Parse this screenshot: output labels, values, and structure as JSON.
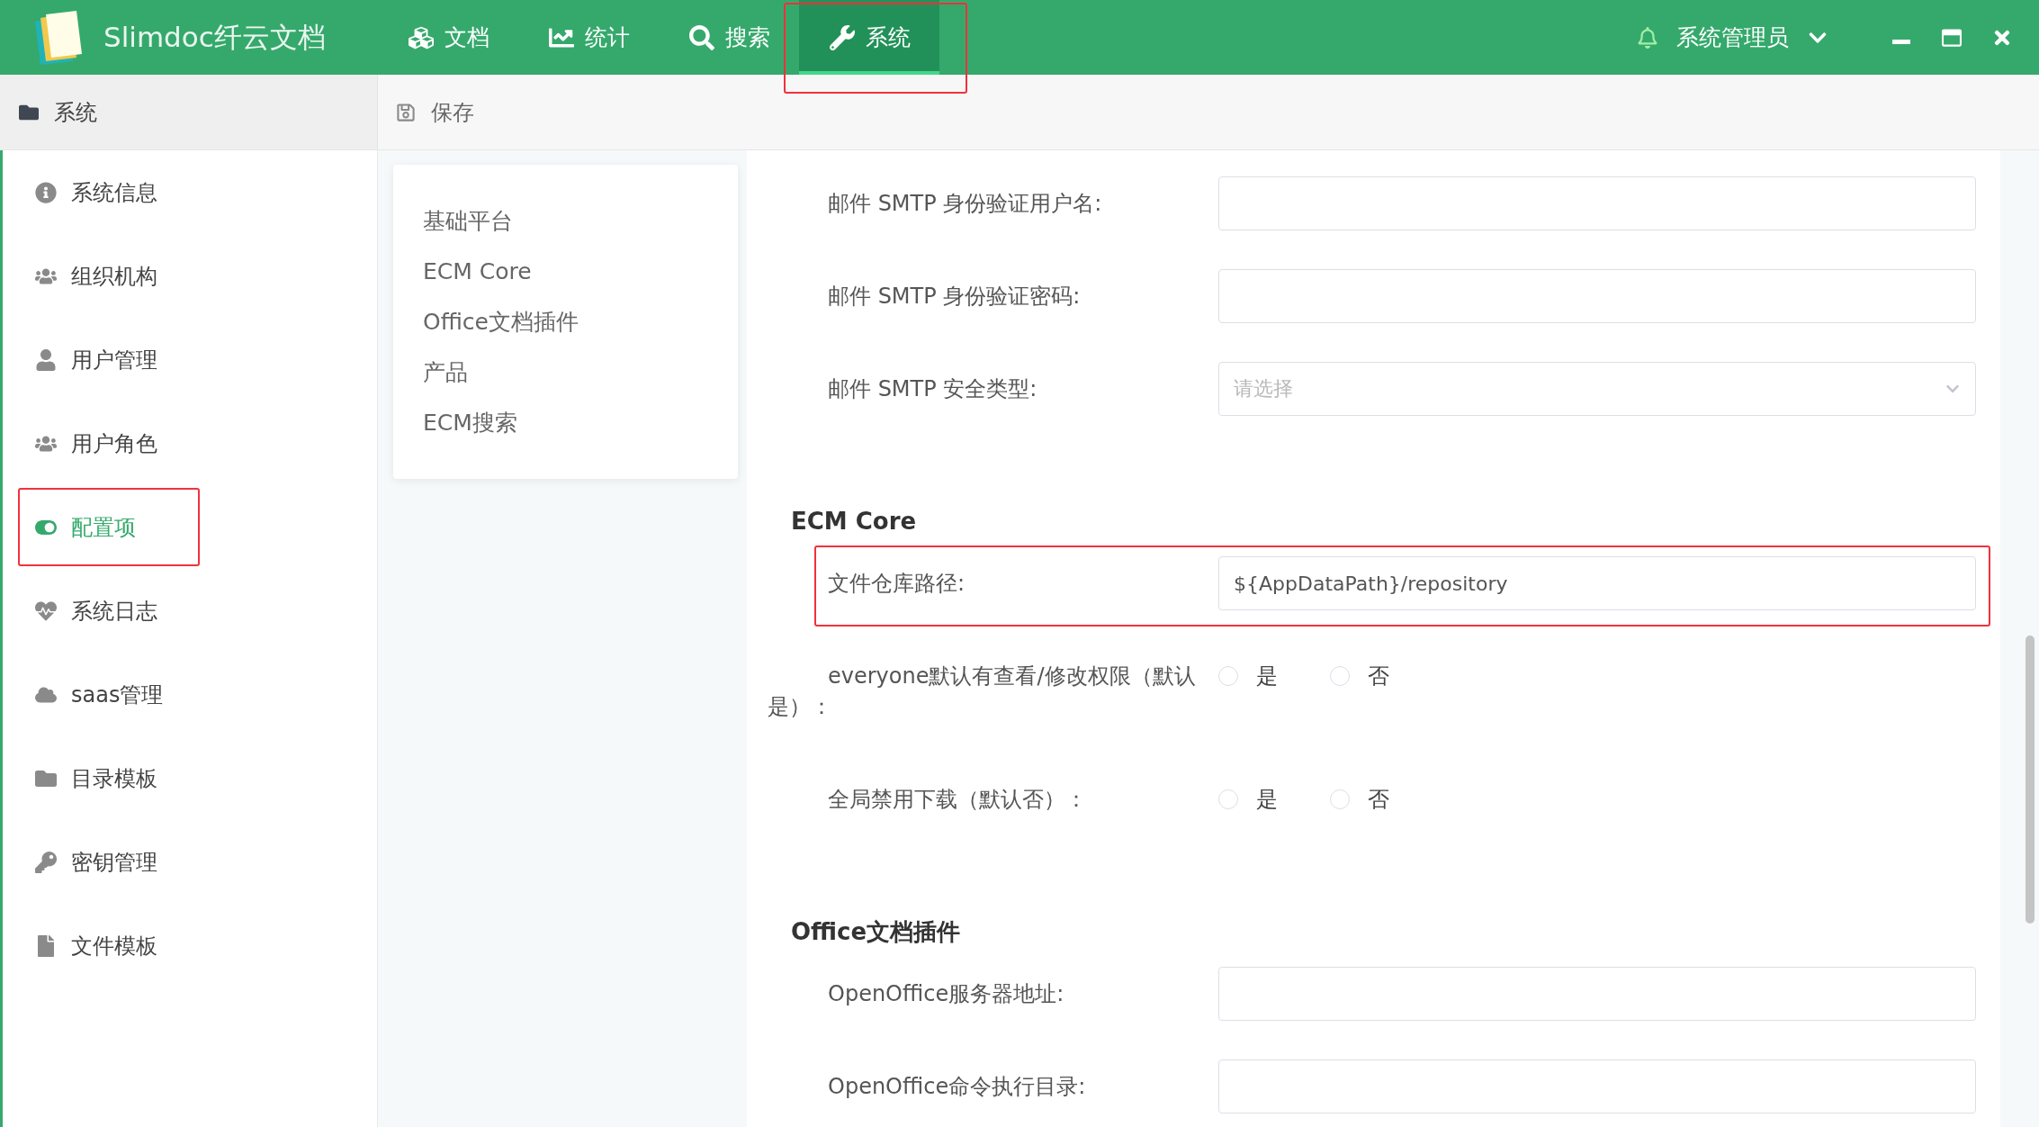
{
  "app": {
    "title": "Slimdoc纤云文档"
  },
  "nav": [
    {
      "label": "文档",
      "selected": false,
      "highlighted": false
    },
    {
      "label": "统计",
      "selected": false,
      "highlighted": false
    },
    {
      "label": "搜索",
      "selected": false,
      "highlighted": false
    },
    {
      "label": "系统",
      "selected": true,
      "highlighted": true
    }
  ],
  "user": {
    "name": "系统管理员"
  },
  "breadcrumb": {
    "label": "系统"
  },
  "toolbar": {
    "save": "保存"
  },
  "sidebar": {
    "items": [
      {
        "label": "系统信息",
        "selected": false,
        "highlighted": false
      },
      {
        "label": "组织机构",
        "selected": false,
        "highlighted": false
      },
      {
        "label": "用户管理",
        "selected": false,
        "highlighted": false
      },
      {
        "label": "用户角色",
        "selected": false,
        "highlighted": false
      },
      {
        "label": "配置项",
        "selected": true,
        "highlighted": true
      },
      {
        "label": "系统日志",
        "selected": false,
        "highlighted": false
      },
      {
        "label": "saas管理",
        "selected": false,
        "highlighted": false
      },
      {
        "label": "目录模板",
        "selected": false,
        "highlighted": false
      },
      {
        "label": "密钥管理",
        "selected": false,
        "highlighted": false
      },
      {
        "label": "文件模板",
        "selected": false,
        "highlighted": false
      }
    ]
  },
  "anchors": [
    "基础平台",
    "ECM Core",
    "Office文档插件",
    "产品",
    "ECM搜索"
  ],
  "form": {
    "sections": [
      {
        "fields": [
          {
            "kind": "text",
            "label": "邮件 SMTP 身份验证用户名:",
            "highlighted": false
          },
          {
            "kind": "text",
            "label": "邮件 SMTP 身份验证密码:",
            "highlighted": false
          },
          {
            "kind": "select",
            "label": "邮件 SMTP 安全类型:",
            "placeholder": "请选择",
            "highlighted": false
          }
        ]
      },
      {
        "title": "ECM Core",
        "fields": [
          {
            "kind": "text",
            "label": "文件仓库路径:",
            "value": "${AppDataPath}/repository",
            "highlighted": true
          },
          {
            "kind": "radio",
            "label": "everyone默认有查看/修改权限（默认是）：",
            "highlighted": false,
            "options": [
              {
                "label": "是",
                "selected": false
              },
              {
                "label": "否",
                "selected": false
              }
            ]
          },
          {
            "kind": "radio",
            "label": "全局禁用下载（默认否）：",
            "highlighted": false,
            "options": [
              {
                "label": "是",
                "selected": false
              },
              {
                "label": "否",
                "selected": false
              }
            ]
          }
        ]
      },
      {
        "title": "Office文档插件",
        "fields": [
          {
            "kind": "text",
            "label": "OpenOffice服务器地址:",
            "highlighted": false
          },
          {
            "kind": "text",
            "label": "OpenOffice命令执行目录:",
            "highlighted": false
          }
        ]
      }
    ]
  }
}
